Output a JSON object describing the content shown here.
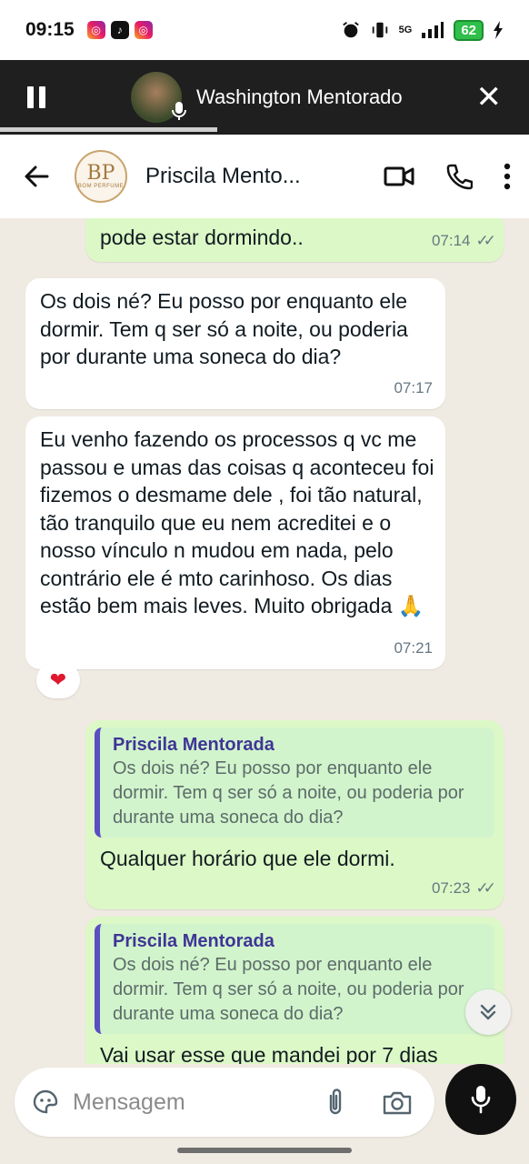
{
  "status_bar": {
    "time": "09:15",
    "apps": [
      "instagram-icon",
      "tiktok-icon",
      "instagram-icon"
    ],
    "network": "5G",
    "battery": "62"
  },
  "call": {
    "name": "Washington Mentorado",
    "progress_fraction": 0.41
  },
  "header": {
    "contact_name": "Priscila Mento...",
    "avatar_logo_letters": "BP",
    "avatar_logo_text": "BOM PERFUME"
  },
  "messages": {
    "m0": {
      "text": "pode estar dormindo..",
      "time": "07:14"
    },
    "m1": {
      "text": "Os dois né? Eu posso por enquanto ele dormir. Tem q ser só a noite, ou poderia por durante uma soneca do dia?",
      "time": "07:17"
    },
    "m2": {
      "text": "Eu venho fazendo os processos q vc me passou e umas das coisas q aconteceu foi fizemos o desmame dele , foi tão natural, tão tranquilo que eu nem acreditei e o nosso vínculo n mudou em nada, pelo contrário ele é mto carinhoso. Os dias estão bem mais leves. Muito obrigada 🙏",
      "time": "07:21",
      "reaction": "❤"
    },
    "m3": {
      "quote_author": "Priscila Mentorada",
      "quote_text": "Os dois né? Eu posso por enquanto ele dormir. Tem q ser só a noite, ou poderia por durante uma soneca do dia?",
      "text": "Qualquer horário que ele dormi.",
      "time": "07:23"
    },
    "m4": {
      "quote_author": "Priscila Mentorada",
      "quote_text": "Os dois né? Eu posso por enquanto ele dormir. Tem q ser só a noite, ou poderia por durante uma soneca do dia?",
      "text": "Vai usar esse que mandei por 7 dias"
    }
  },
  "input": {
    "placeholder": "Mensagem"
  }
}
